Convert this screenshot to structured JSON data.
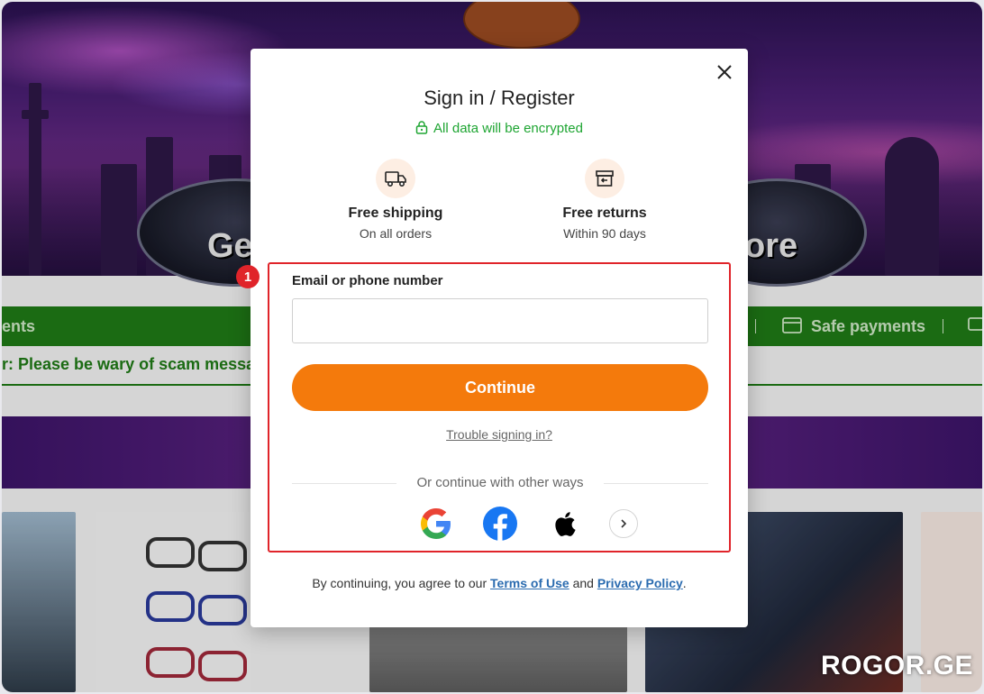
{
  "background": {
    "hero_text_left": "Get",
    "hero_text_right": "ore",
    "green_bar": {
      "left_label": "ents",
      "right_label": "Safe payments"
    },
    "notice_text": "r: Please be wary of scam messag",
    "watermark": "ROGOR.GE"
  },
  "modal": {
    "title": "Sign in / Register",
    "encrypt_text": "All data will be encrypted",
    "benefits": [
      {
        "title": "Free shipping",
        "subtitle": "On all orders",
        "icon": "truck-icon"
      },
      {
        "title": "Free returns",
        "subtitle": "Within 90 days",
        "icon": "return-box-icon"
      }
    ],
    "annotation_badge": "1",
    "field_label": "Email or phone number",
    "field_value": "",
    "field_placeholder": "",
    "continue_label": "Continue",
    "trouble_link": "Trouble signing in?",
    "or_text": "Or continue with other ways",
    "social": [
      "google-icon",
      "facebook-icon",
      "apple-icon",
      "chevron-right-icon"
    ],
    "terms": {
      "prefix": "By continuing, you agree to our ",
      "terms_link": "Terms of Use",
      "middle": " and ",
      "privacy_link": "Privacy Policy",
      "suffix": "."
    }
  },
  "colors": {
    "accent_orange": "#f47a0c",
    "encrypt_green": "#1ea532",
    "highlight_red": "#e0242a",
    "link_blue": "#2b6cb0",
    "bar_green": "#1f7a16"
  }
}
